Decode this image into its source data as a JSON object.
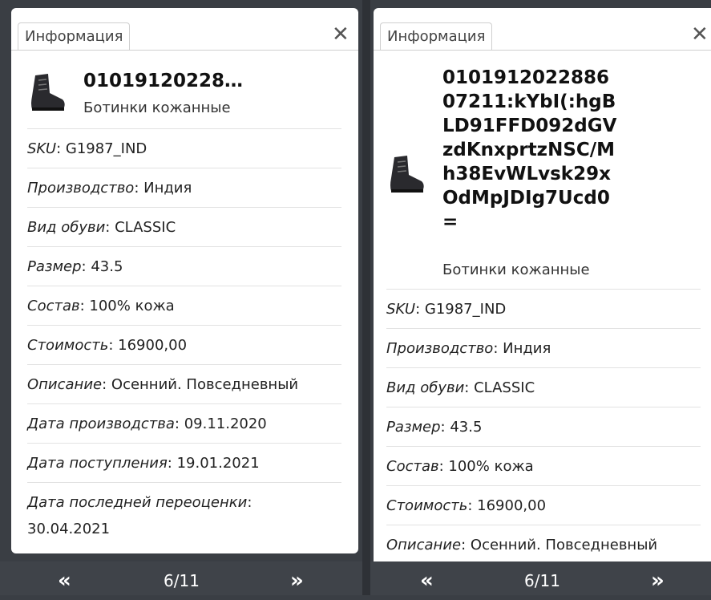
{
  "left_panel": {
    "tab_label": "Информация",
    "close_glyph": "✕",
    "title": "01019120228…",
    "subtitle": "Ботинки кожанные",
    "rows": [
      {
        "key": "SKU",
        "value": ": G1987_IND"
      },
      {
        "key": "Производство",
        "value": ": Индия"
      },
      {
        "key": "Вид обуви",
        "value": ": CLASSIC"
      },
      {
        "key": "Размер",
        "value": ": 43.5"
      },
      {
        "key": "Состав",
        "value": ": 100% кожа"
      },
      {
        "key": "Стоимость",
        "value": ": 16900,00"
      },
      {
        "key": "Описание",
        "value": ": Осенний. Повседневный"
      },
      {
        "key": "Дата производства",
        "value": ": 09.11.2020"
      },
      {
        "key": "Дата поступления",
        "value": ": 19.01.2021"
      },
      {
        "key": "Дата последней переоценки",
        "value": ":"
      },
      {
        "key": "",
        "value": "30.04.2021"
      }
    ],
    "pager": {
      "prev": "«",
      "page": "6/11",
      "next": "»"
    }
  },
  "right_panel": {
    "tab_label": "Информация",
    "close_glyph": "✕",
    "title_lines": [
      "0101912022886",
      "07211:kYbI(:hgB",
      "LD91FFD092dGV",
      "zdKnxprtzNSC/M",
      "h38EvWLvsk29x",
      "OdMpJDIg7Ucd0",
      "="
    ],
    "subtitle": "Ботинки кожанные",
    "rows": [
      {
        "key": "SKU",
        "value": ": G1987_IND"
      },
      {
        "key": "Производство",
        "value": ": Индия"
      },
      {
        "key": "Вид обуви",
        "value": ": CLASSIC"
      },
      {
        "key": "Размер",
        "value": ": 43.5"
      },
      {
        "key": "Состав",
        "value": ": 100% кожа"
      },
      {
        "key": "Стоимость",
        "value": ": 16900,00"
      },
      {
        "key": "Описание",
        "value": ": Осенний. Повседневный"
      }
    ],
    "pager": {
      "prev": "«",
      "page": "6/11",
      "next": "»"
    }
  }
}
